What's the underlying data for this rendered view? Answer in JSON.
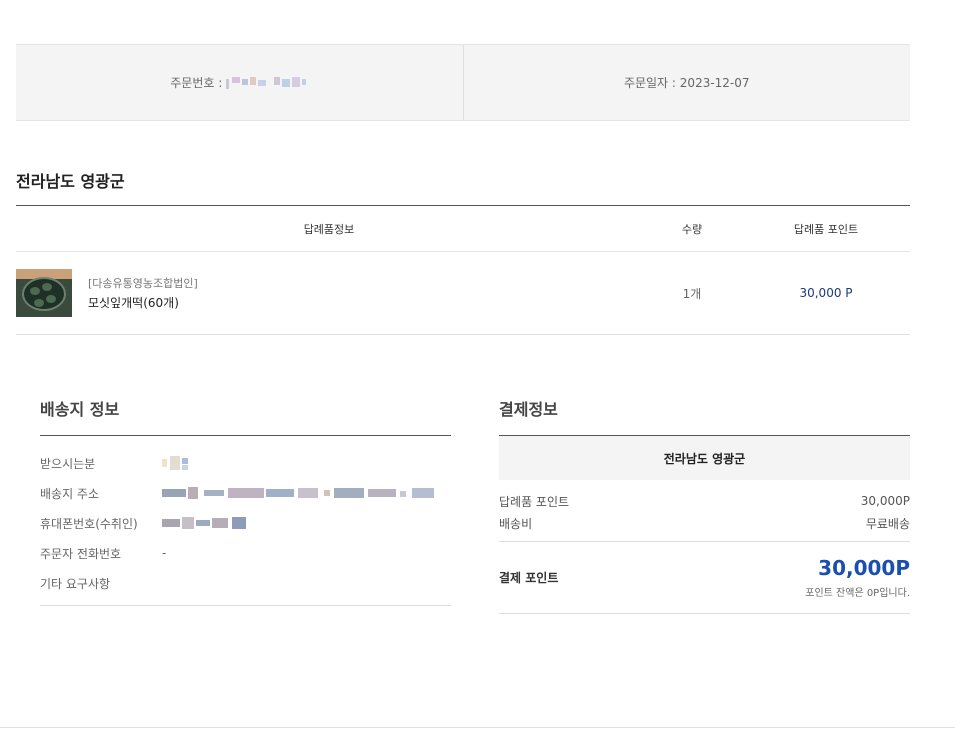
{
  "order": {
    "number_label": "주문번호 :",
    "date_label": "주문일자 :",
    "date_value": "2023-12-07"
  },
  "region_title": "전라남도 영광군",
  "table": {
    "headers": [
      "답례품정보",
      "수량",
      "답례품 포인트"
    ],
    "items": [
      {
        "brand": "[다송유통영농조합법인]",
        "name": "모싯잎개떡(60개)",
        "qty": "1개",
        "points": "30,000 P"
      }
    ]
  },
  "shipping": {
    "title": "배송지 정보",
    "rows": [
      {
        "label": "받으시는분",
        "value": ""
      },
      {
        "label": "배송지 주소",
        "value": ""
      },
      {
        "label": "휴대폰번호(수취인)",
        "value": ""
      },
      {
        "label": "주문자 전화번호",
        "value": "-"
      },
      {
        "label": "기타 요구사항",
        "value": ""
      }
    ]
  },
  "payment": {
    "title": "결제정보",
    "region": "전라남도 영광군",
    "lines": [
      {
        "label": "답례품 포인트",
        "value": "30,000P"
      },
      {
        "label": "배송비",
        "value": "무료배송"
      }
    ],
    "total_label": "결제 포인트",
    "total_value": "30,000P",
    "balance_note": "포인트 잔액은 0P입니다."
  },
  "colors": {
    "accent": "#1a4fb0",
    "points_text": "#1d3a7a",
    "panel_bg": "#f4f4f4"
  }
}
